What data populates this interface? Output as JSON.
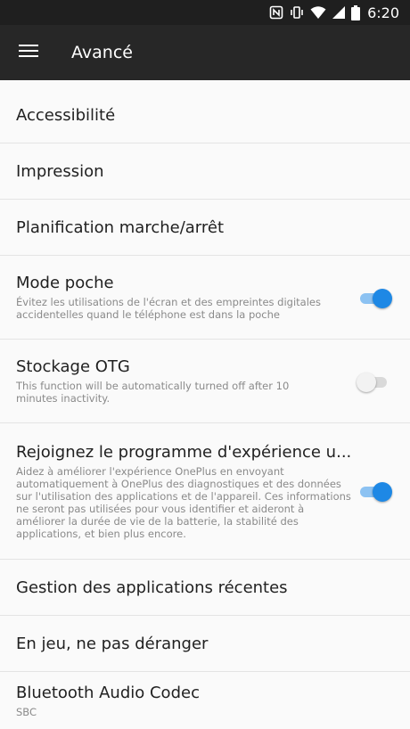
{
  "status_bar": {
    "time": "6:20"
  },
  "toolbar": {
    "title": "Avancé"
  },
  "items": [
    {
      "label": "Accessibilité"
    },
    {
      "label": "Impression"
    },
    {
      "label": "Planification marche/arrêt"
    },
    {
      "label": "Mode poche",
      "desc": "Évitez les utilisations de l'écran et des empreintes digitales accidentelles quand le téléphone est dans la poche",
      "toggle": "on"
    },
    {
      "label": "Stockage OTG",
      "desc": "This function will be automatically turned off after 10 minutes inactivity.",
      "toggle": "off"
    },
    {
      "label": "Rejoignez le programme d'expérience u...",
      "desc": "Aidez à améliorer l'expérience OnePlus en envoyant automatiquement à OnePlus des diagnostiques et des données sur l'utilisation des applications et de l'appareil. Ces informations ne seront pas utilisées pour vous identifier et aideront à améliorer la durée de vie de la batterie, la stabilité des applications, et bien plus encore.",
      "toggle": "on"
    },
    {
      "label": "Gestion des applications récentes"
    },
    {
      "label": "En jeu, ne pas déranger"
    },
    {
      "label": "Bluetooth Audio Codec",
      "desc": "SBC"
    }
  ],
  "colors": {
    "accent": "#1e88e5",
    "toolbar": "#272727",
    "status_bar": "#1f1f1f",
    "background": "#fafafa"
  }
}
